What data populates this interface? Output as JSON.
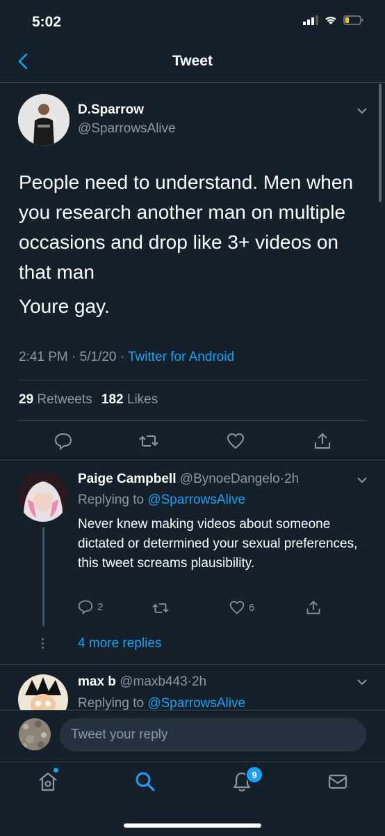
{
  "status": {
    "time": "5:02"
  },
  "header": {
    "title": "Tweet"
  },
  "tweet": {
    "name": "D.Sparrow",
    "handle": "@SparrowsAlive",
    "text_p1": "People need to understand. Men when you research another man on multiple occasions and drop like 3+ videos on that man",
    "text_p2": "Youre gay.",
    "time": "2:41 PM",
    "date": "5/1/20",
    "source": "Twitter for Android",
    "retweets_count": "29",
    "retweets_label": "Retweets",
    "likes_count": "182",
    "likes_label": "Likes"
  },
  "replies": [
    {
      "name": "Paige Campbell",
      "handle": "@BynoeDangelo",
      "age": "2h",
      "replying_prefix": "Replying to",
      "replying_to": "@SparrowsAlive",
      "text": "Never knew making videos about someone dictated or determined your sexual preferences, this tweet screams plausibility.",
      "reply_count": "2",
      "like_count": "6",
      "more_replies": "4 more replies"
    },
    {
      "name": "max b",
      "handle": "@maxb443",
      "age": "2h",
      "replying_prefix": "Replying to",
      "replying_to": "@SparrowsAlive"
    }
  ],
  "composer": {
    "placeholder": "Tweet your reply"
  },
  "tabbar": {
    "notifications_badge": "9"
  },
  "colors": {
    "background": "#15202b",
    "accent": "#1da1f2",
    "muted": "#8899a6",
    "divider": "#38444d"
  }
}
